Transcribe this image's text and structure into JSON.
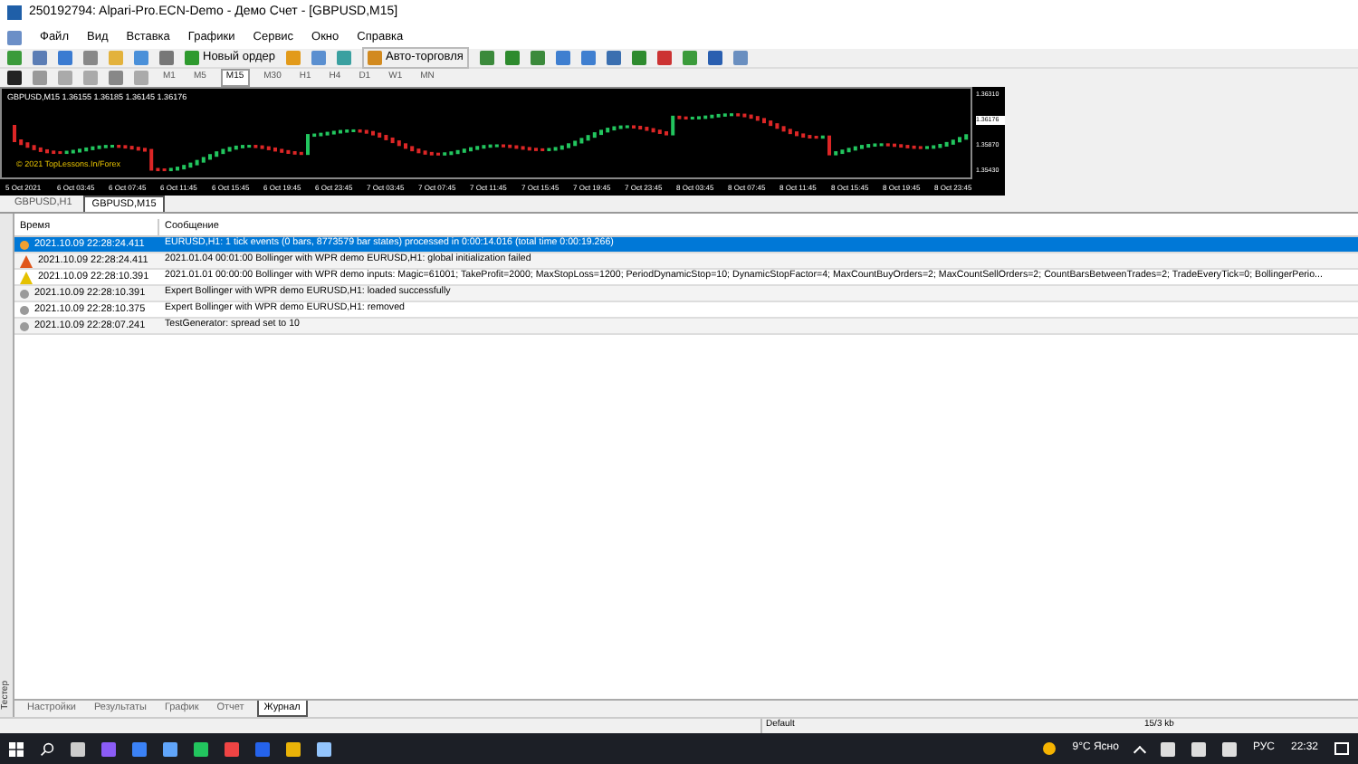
{
  "window": {
    "title": "250192794: Alpari-Pro.ECN-Demo - Демо Счет - [GBPUSD,M15]"
  },
  "menu": [
    "Файл",
    "Вид",
    "Вставка",
    "Графики",
    "Сервис",
    "Окно",
    "Справка"
  ],
  "toolbar": {
    "new_order": "Новый ордер",
    "auto_trading": "Авто-торговля"
  },
  "periods": [
    {
      "label": "M1",
      "selected": false
    },
    {
      "label": "M5",
      "selected": false
    },
    {
      "label": "M15",
      "selected": true
    },
    {
      "label": "M30",
      "selected": false
    },
    {
      "label": "H1",
      "selected": false
    },
    {
      "label": "H4",
      "selected": false
    },
    {
      "label": "D1",
      "selected": false
    },
    {
      "label": "W1",
      "selected": false
    },
    {
      "label": "MN",
      "selected": false
    }
  ],
  "chart": {
    "header": "GBPUSD,M15  1.36155 1.36185 1.36145 1.36176",
    "copyright": "© 2021 TopLessons.In/Forex",
    "price_labels": [
      "1.36310",
      "1.36176",
      "1.35870",
      "1.35430"
    ],
    "time_labels": [
      "5 Oct 2021",
      "6 Oct 03:45",
      "6 Oct 07:45",
      "6 Oct 11:45",
      "6 Oct 15:45",
      "6 Oct 19:45",
      "6 Oct 23:45",
      "7 Oct 03:45",
      "7 Oct 07:45",
      "7 Oct 11:45",
      "7 Oct 15:45",
      "7 Oct 19:45",
      "7 Oct 23:45",
      "8 Oct 03:45",
      "8 Oct 07:45",
      "8 Oct 11:45",
      "8 Oct 15:45",
      "8 Oct 19:45",
      "8 Oct 23:45"
    ]
  },
  "chart_tabs": [
    {
      "label": "GBPUSD,H1",
      "selected": false
    },
    {
      "label": "GBPUSD,M15",
      "selected": true
    }
  ],
  "journal": {
    "columns": [
      "Время",
      "Сообщение"
    ],
    "rows": [
      {
        "kind": "info",
        "selected": true,
        "time": "2021.10.09 22:28:24.411",
        "message": "EURUSD,H1: 1 tick events (0 bars, 8773579 bar states) processed in 0:00:14.016 (total time 0:00:19.266)"
      },
      {
        "kind": "error",
        "selected": false,
        "time": "2021.10.09 22:28:24.411",
        "message": "2021.01.04 00:01:00  Bollinger with WPR demo EURUSD,H1: global initialization failed"
      },
      {
        "kind": "warning",
        "selected": false,
        "time": "2021.10.09 22:28:10.391",
        "message": "2021.01.01 00:00:00  Bollinger with WPR demo inputs: Magic=61001; TakeProfit=2000; MaxStopLoss=1200; PeriodDynamicStop=10; DynamicStopFactor=4; MaxCountBuyOrders=2; MaxCountSellOrders=2; CountBarsBetweenTrades=2; TradeEveryTick=0; BollingerPerio..."
      },
      {
        "kind": "info",
        "selected": false,
        "time": "2021.10.09 22:28:10.391",
        "message": "Expert Bollinger with WPR demo EURUSD,H1: loaded successfully"
      },
      {
        "kind": "info",
        "selected": false,
        "time": "2021.10.09 22:28:10.375",
        "message": "Expert Bollinger with WPR demo EURUSD,H1: removed"
      },
      {
        "kind": "info",
        "selected": false,
        "time": "2021.10.09 22:28:07.241",
        "message": "TestGenerator: spread set to 10"
      }
    ]
  },
  "side_label": "Тестер",
  "bottom_tabs": [
    {
      "label": "Настройки",
      "selected": false
    },
    {
      "label": "Результаты",
      "selected": false
    },
    {
      "label": "График",
      "selected": false
    },
    {
      "label": "Отчет",
      "selected": false
    },
    {
      "label": "Журнал",
      "selected": true
    }
  ],
  "status_bar": {
    "profile": "Default",
    "traffic": "15/3 kb"
  },
  "taskbar": {
    "weather": "9°C  Ясно",
    "language": "РУС",
    "time": "22:32"
  }
}
